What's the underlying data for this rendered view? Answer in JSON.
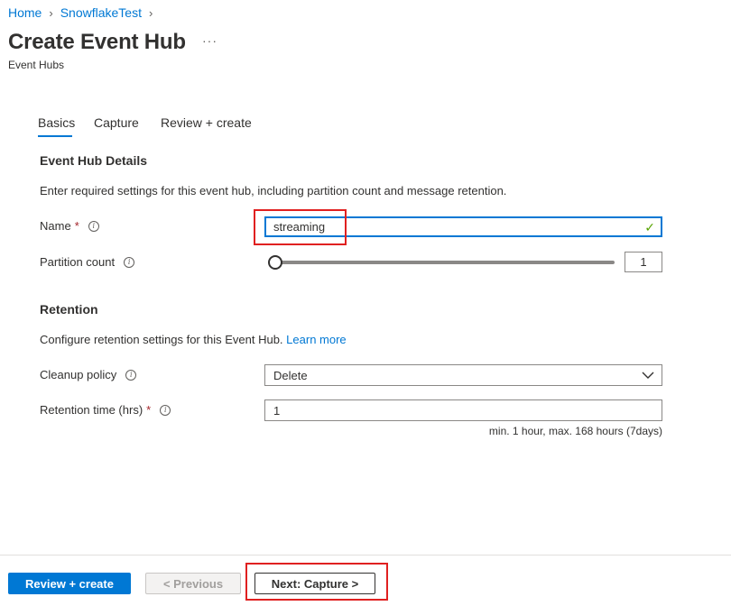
{
  "breadcrumb": {
    "items": [
      "Home",
      "SnowflakeTest"
    ]
  },
  "page": {
    "title": "Create Event Hub",
    "subtitle": "Event Hubs",
    "more_glyph": "···"
  },
  "tabs": [
    {
      "label": "Basics",
      "active": true
    },
    {
      "label": "Capture",
      "active": false
    },
    {
      "label": "Review + create",
      "active": false
    }
  ],
  "details": {
    "heading": "Event Hub Details",
    "description": "Enter required settings for this event hub, including partition count and message retention.",
    "name_label": "Name",
    "name_value": "streaming",
    "partition_label": "Partition count",
    "partition_value": "1"
  },
  "retention": {
    "heading": "Retention",
    "description": "Configure retention settings for this Event Hub.",
    "learn_more": "Learn more",
    "cleanup_label": "Cleanup policy",
    "cleanup_value": "Delete",
    "time_label": "Retention time (hrs)",
    "time_value": "1",
    "time_hint": "min. 1 hour, max. 168 hours (7days)"
  },
  "footer": {
    "review_create": "Review + create",
    "previous": "< Previous",
    "next": "Next: Capture >"
  },
  "icons": {
    "info": "i",
    "required": "*",
    "check": "✓",
    "chevron_right": "›"
  },
  "colors": {
    "accent": "#0078d4",
    "required": "#a4262c",
    "highlight": "#e02020",
    "valid": "#57a300"
  }
}
